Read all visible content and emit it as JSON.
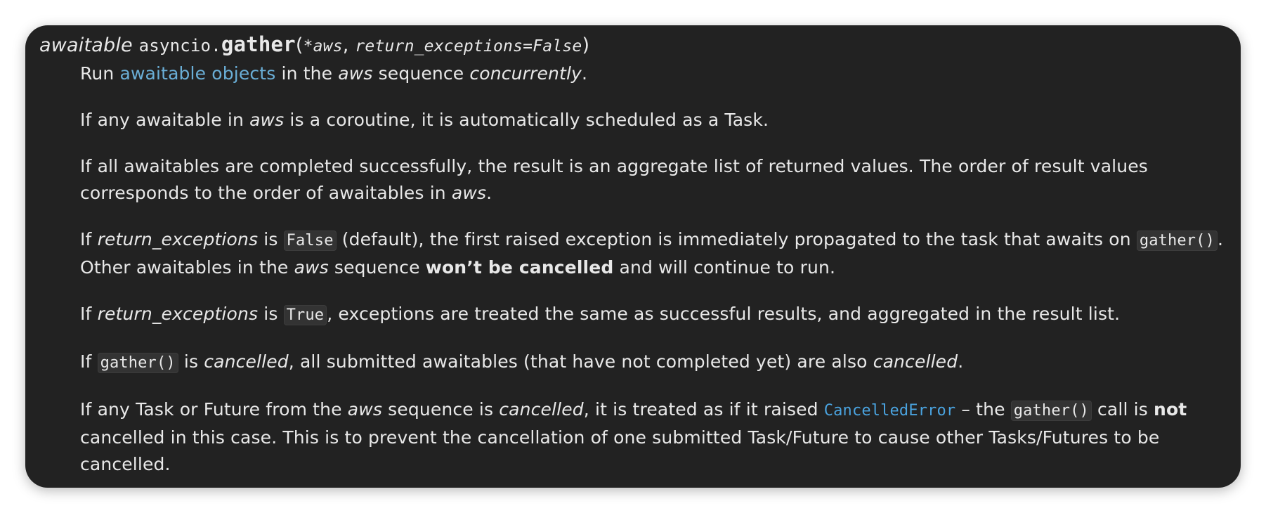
{
  "signature": {
    "prefix": "awaitable",
    "module": "asyncio.",
    "name": "gather",
    "open_paren": "(",
    "arg1": "*aws",
    "comma": ", ",
    "arg2": "return_exceptions=False",
    "close_paren": ")"
  },
  "p1": {
    "t1": "Run ",
    "link": "awaitable objects",
    "t2": " in the ",
    "em1": "aws",
    "t3": " sequence ",
    "em2": "concurrently",
    "t4": "."
  },
  "p2": {
    "t1": "If any awaitable in ",
    "em1": "aws",
    "t2": " is a coroutine, it is automatically scheduled as a Task."
  },
  "p3": {
    "t1": "If all awaitables are completed successfully, the result is an aggregate list of returned values. The order of result values corresponds to the order of awaitables in ",
    "em1": "aws",
    "t2": "."
  },
  "p4": {
    "t1": "If ",
    "em1": "return_exceptions",
    "t2": " is ",
    "code1": "False",
    "t3": " (default), the first raised exception is immediately propagated to the task that awaits on ",
    "code2": "gather()",
    "t4": ". Other awaitables in the ",
    "em2": "aws",
    "t5": " sequence ",
    "b1": "won’t be cancelled",
    "t6": " and will continue to run."
  },
  "p5": {
    "t1": "If ",
    "em1": "return_exceptions",
    "t2": " is ",
    "code1": "True",
    "t3": ", exceptions are treated the same as successful results, and aggregated in the result list."
  },
  "p6": {
    "t1": "If ",
    "code1": "gather()",
    "t2": " is ",
    "em1": "cancelled",
    "t3": ", all submitted awaitables (that have not completed yet) are also ",
    "em2": "cancelled",
    "t4": "."
  },
  "p7": {
    "t1": "If any Task or Future from the ",
    "em1": "aws",
    "t2": " sequence is ",
    "em2": "cancelled",
    "t3": ", it is treated as if it raised ",
    "link_code": "CancelledError",
    "t4": " – the ",
    "code1": "gather()",
    "t5": " call is ",
    "b1": "not",
    "t6": " cancelled in this case. This is to prevent the cancellation of one submitted Task/Future to cause other Tasks/Futures to be cancelled."
  }
}
